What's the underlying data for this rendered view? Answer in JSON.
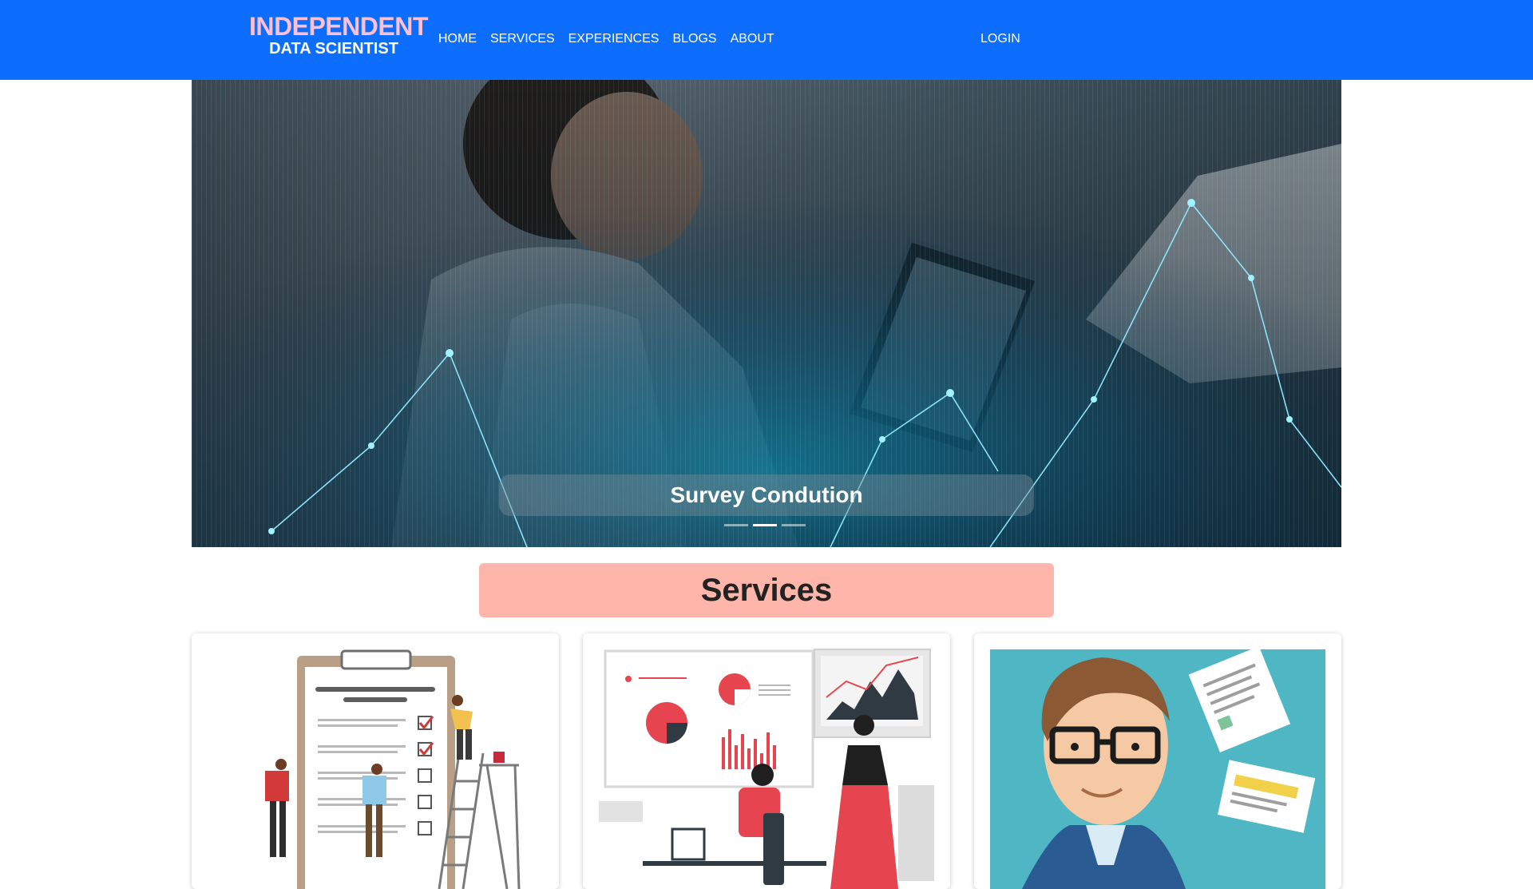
{
  "brand": {
    "line1": "INDEPENDENT",
    "line2": "DATA SCIENTIST"
  },
  "nav": {
    "links": [
      "HOME",
      "SERVICES",
      "EXPERIENCES",
      "BLOGS",
      "ABOUT"
    ],
    "login": "LOGIN"
  },
  "hero": {
    "caption": "Survey Condution",
    "indicator_count": 3,
    "active_indicator": 2
  },
  "services": {
    "title": "Services",
    "cards": [
      {
        "image": "survey-checklist-illustration"
      },
      {
        "image": "data-analysis-dashboard-illustration"
      },
      {
        "image": "data-scientist-avatar-illustration"
      }
    ]
  },
  "colors": {
    "navbar": "#0d6efd",
    "brand_accent": "#ffc0d5",
    "services_banner": "#ffb6aa"
  }
}
